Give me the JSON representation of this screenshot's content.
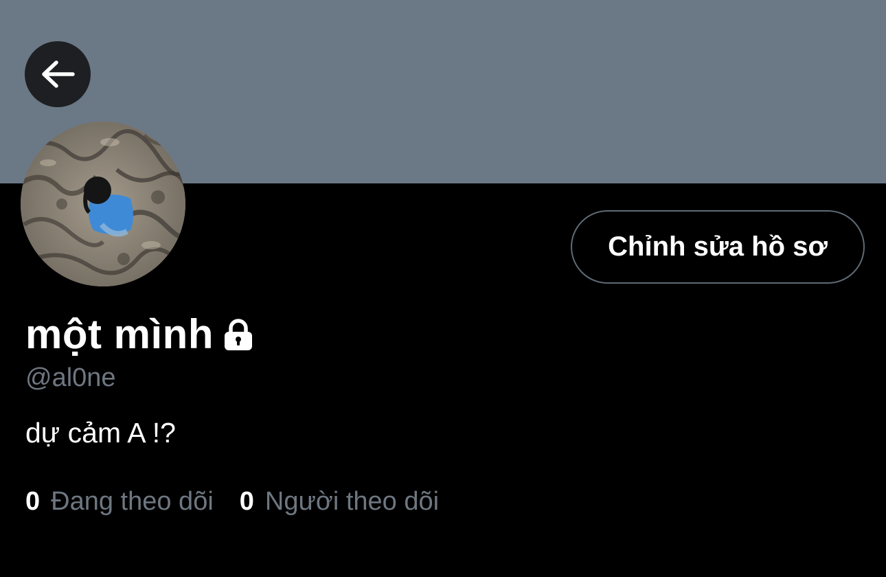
{
  "header": {
    "back_icon": "arrow-left-icon",
    "banner_color": "#6b7886"
  },
  "profile": {
    "display_name": "một mình",
    "protected_icon": "lock-icon",
    "handle": "@al0ne",
    "bio": "dự cảm A !?",
    "edit_button_label": "Chỉnh sửa hồ sơ"
  },
  "stats": {
    "following_count": "0",
    "following_label": "Đang theo dõi",
    "followers_count": "0",
    "followers_label": "Người theo dõi"
  },
  "colors": {
    "background": "#000000",
    "text_primary": "#ffffff",
    "text_secondary": "#6e7781",
    "button_border": "#5f6b77"
  }
}
